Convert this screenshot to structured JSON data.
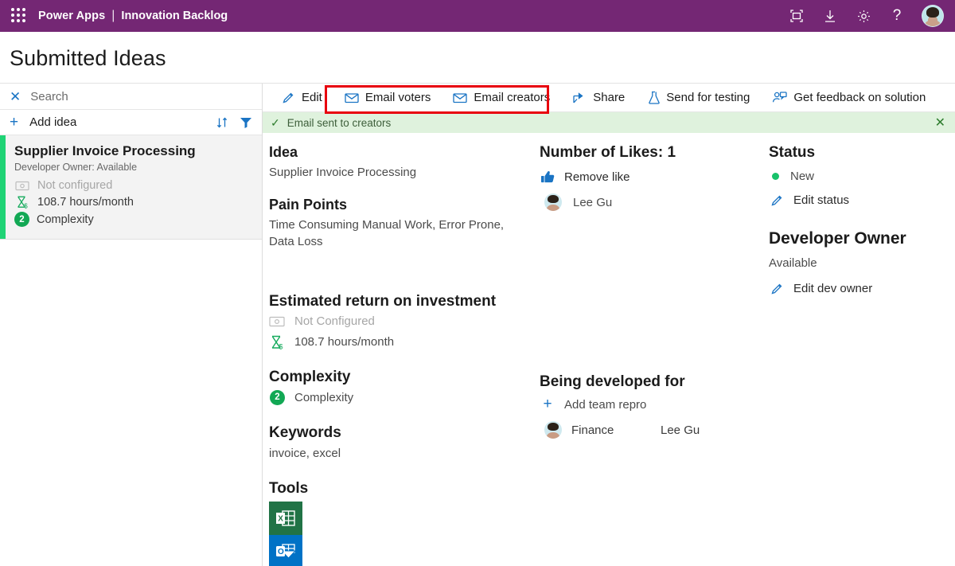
{
  "topbar": {
    "waffle_icon": "app-launcher-icon",
    "brand": "Power Apps",
    "separator": "|",
    "app_name": "Innovation Backlog",
    "icons": [
      {
        "name": "fit-to-screen-icon",
        "glyph": "full-screen"
      },
      {
        "name": "download-icon",
        "glyph": "download"
      },
      {
        "name": "settings-icon",
        "glyph": "gear"
      },
      {
        "name": "help-icon",
        "glyph": "?"
      }
    ],
    "avatar": "user-avatar"
  },
  "page": {
    "title": "Submitted Ideas"
  },
  "left_panel": {
    "search": {
      "clear_icon": "close-icon",
      "placeholder": "Search",
      "value": ""
    },
    "add": {
      "plus_icon": "plus-icon",
      "label": "Add idea"
    },
    "sort_icon": "sort-icon",
    "filter_icon": "filter-icon",
    "cards": [
      {
        "title": "Supplier Invoice Processing",
        "subtitle": "Developer Owner: Available",
        "roi_money": "Not configured",
        "roi_hours": "108.7 hours/month",
        "complexity_badge": "2",
        "complexity_label": "Complexity",
        "accent_color": "#1fd375"
      }
    ]
  },
  "command_bar": {
    "items": [
      {
        "label": "Edit",
        "icon": "pencil-icon"
      },
      {
        "label": "Email voters",
        "icon": "mail-icon"
      },
      {
        "label": "Email creators",
        "icon": "mail-icon"
      },
      {
        "label": "Share",
        "icon": "share-icon"
      },
      {
        "label": "Send for testing",
        "icon": "flask-icon"
      },
      {
        "label": "Get feedback on solution",
        "icon": "person-feedback-icon"
      }
    ],
    "highlight_color": "#e8000d"
  },
  "notification": {
    "check_icon": "check-icon",
    "message": "Email sent to creators",
    "close_icon": "close-icon",
    "background": "#dff2dd"
  },
  "detail": {
    "column_a": {
      "idea_heading": "Idea",
      "idea_value": "Supplier Invoice Processing",
      "pain_heading": "Pain Points",
      "pain_value": "Time Consuming Manual Work, Error Prone, Data Loss",
      "roi_heading": "Estimated return on investment",
      "roi_money": "Not Configured",
      "roi_money_icon": "money-icon",
      "roi_hours": "108.7 hours/month",
      "roi_hours_icon": "hourglass-money-icon",
      "complexity_heading": "Complexity",
      "complexity_badge": "2",
      "complexity_value": "Complexity",
      "keywords_heading": "Keywords",
      "keywords_value": "invoice, excel",
      "tools_heading": "Tools",
      "tools": [
        {
          "name": "excel-icon",
          "label": "Excel",
          "color": "#217346"
        },
        {
          "name": "outlook-icon",
          "label": "Outlook",
          "color": "#0072c6"
        }
      ]
    },
    "column_b": {
      "likes_heading": "Number of Likes: 1",
      "remove_like_label": "Remove like",
      "remove_like_icon": "thumbs-up-icon",
      "voters": [
        {
          "name": "Lee Gu",
          "avatar": "voter-avatar"
        }
      ],
      "developed_heading": "Being developed for",
      "add_team_label": "Add team repro",
      "add_team_icon": "plus-icon",
      "teams": [
        {
          "team": "Finance",
          "owner": "Lee Gu",
          "avatar": "team-avatar"
        }
      ]
    },
    "column_c": {
      "status_heading": "Status",
      "status_value": "New",
      "status_dot_color": "#17c26a",
      "edit_status_label": "Edit status",
      "edit_status_icon": "pencil-icon",
      "dev_owner_heading": "Developer Owner",
      "dev_owner_value": "Available",
      "edit_dev_owner_label": "Edit dev owner",
      "edit_dev_owner_icon": "pencil-icon"
    }
  }
}
